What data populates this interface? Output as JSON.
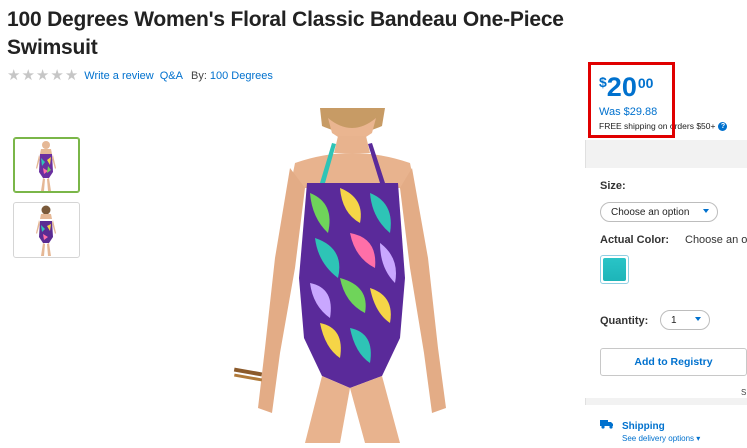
{
  "product": {
    "title": "100 Degrees Women's Floral Classic Bandeau One-Piece Swimsuit",
    "rating_stars": 5,
    "write_review": "Write a review",
    "qa": "Q&A",
    "by_label": "By:",
    "brand": "100 Degrees"
  },
  "price": {
    "currency": "$",
    "dollars": "20",
    "cents": "00",
    "was": "Was $29.88",
    "free_shipping_note": "FREE shipping on orders $50+"
  },
  "options": {
    "size_label": "Size:",
    "size_placeholder": "Choose an option",
    "color_label": "Actual Color:",
    "color_placeholder": "Choose an o",
    "quantity_label": "Quantity:",
    "quantity_value": "1",
    "registry_button": "Add to Registry",
    "right_edge_text": "S"
  },
  "shipping": {
    "title": "Shipping",
    "subtitle": "See delivery options"
  },
  "colors": {
    "accent": "#0071ce",
    "highlight": "#e00000",
    "thumb_active": "#7ab648"
  }
}
